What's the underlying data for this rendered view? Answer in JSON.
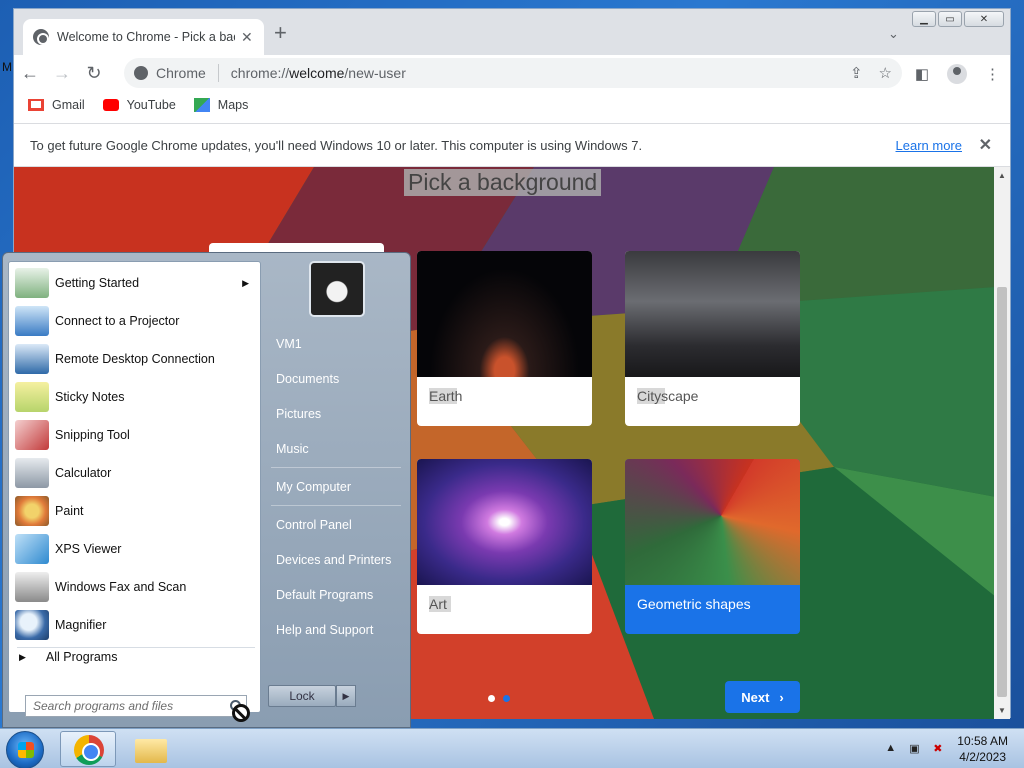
{
  "desktop": {
    "edge_letter": "M"
  },
  "browser": {
    "tab_title": "Welcome to Chrome - Pick a bac",
    "address": {
      "chip": "Chrome",
      "url_prefix": "chrome://",
      "url_host": "welcome",
      "url_path": "/new-user"
    },
    "bookmarks": [
      {
        "label": "Gmail",
        "color": "#ea4335"
      },
      {
        "label": "YouTube",
        "color": "#ff0000"
      },
      {
        "label": "Maps",
        "color": "#34a853"
      }
    ],
    "infobar": {
      "text": "To get future Google Chrome updates, you'll need Windows 10 or later. This computer is using Windows 7.",
      "link": "Learn more"
    }
  },
  "page": {
    "title": "Pick a background",
    "cards": [
      {
        "label": "Earth"
      },
      {
        "label": "Cityscape"
      },
      {
        "label": "Art"
      },
      {
        "label": "Geometric shapes",
        "selected": true
      }
    ],
    "next_label": "Next",
    "accent": "#1a73e8"
  },
  "startmenu": {
    "programs": [
      {
        "label": "Getting Started",
        "submenu": true
      },
      {
        "label": "Connect to a Projector"
      },
      {
        "label": "Remote Desktop Connection"
      },
      {
        "label": "Sticky Notes"
      },
      {
        "label": "Snipping Tool"
      },
      {
        "label": "Calculator"
      },
      {
        "label": "Paint"
      },
      {
        "label": "XPS Viewer"
      },
      {
        "label": "Windows Fax and Scan"
      },
      {
        "label": "Magnifier"
      }
    ],
    "all_programs": "All Programs",
    "search_placeholder": "Search programs and files",
    "right_items": [
      "VM1",
      "Documents",
      "Pictures",
      "Music",
      "My Computer",
      "Control Panel",
      "Devices and Printers",
      "Default Programs",
      "Help and Support"
    ],
    "lock_label": "Lock"
  },
  "taskbar": {
    "time": "10:58 AM",
    "date": "4/2/2023"
  }
}
